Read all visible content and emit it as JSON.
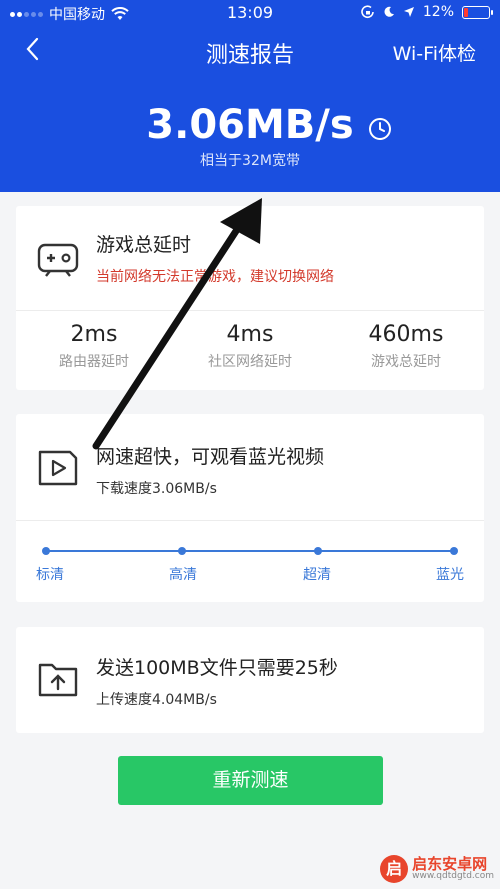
{
  "status_bar": {
    "carrier": "中国移动",
    "time": "13:09",
    "battery": "12%"
  },
  "nav": {
    "title": "测速报告",
    "right_label": "Wi-Fi体检"
  },
  "summary": {
    "speed": "3.06MB/s",
    "equivalent": "相当于32M宽带"
  },
  "game_card": {
    "title": "游戏总延时",
    "warning": "当前网络无法正常游戏，建议切换网络",
    "stats": [
      {
        "value": "2ms",
        "label": "路由器延时"
      },
      {
        "value": "4ms",
        "label": "社区网络延时"
      },
      {
        "value": "460ms",
        "label": "游戏总延时"
      }
    ]
  },
  "video_card": {
    "title": "网速超快，可观看蓝光视频",
    "download": "下载速度3.06MB/s",
    "levels": [
      "标清",
      "高清",
      "超清",
      "蓝光"
    ]
  },
  "upload_card": {
    "title": "发送100MB文件只需要25秒",
    "upload": "上传速度4.04MB/s"
  },
  "retest_button": "重新测速",
  "watermark": {
    "title": "启东安卓网",
    "url": "www.qdtdgtd.com"
  },
  "colors": {
    "header": "#1a4fe0",
    "accent": "#3a78d8",
    "button": "#28c766",
    "warning": "#d33a2c"
  }
}
